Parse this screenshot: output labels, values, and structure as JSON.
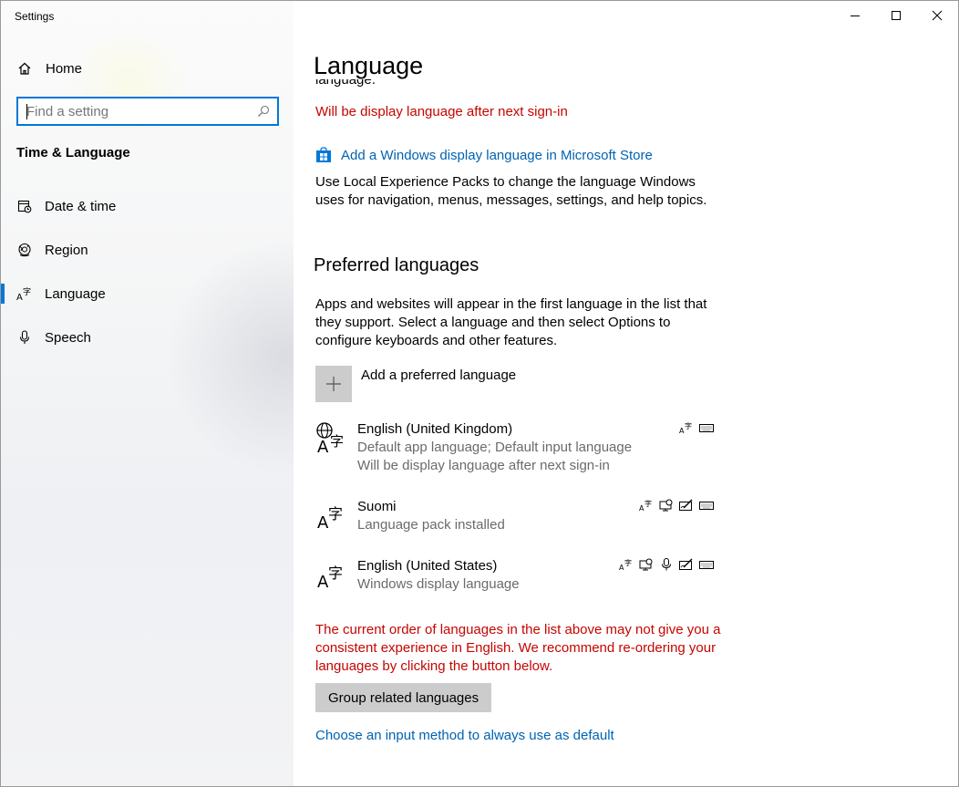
{
  "window": {
    "app_title": "Settings"
  },
  "sidebar": {
    "home_label": "Home",
    "search_placeholder": "Find a setting",
    "section_title": "Time & Language",
    "items": [
      {
        "label": "Date & time",
        "icon": "date-time-icon",
        "selected": false
      },
      {
        "label": "Region",
        "icon": "globe-icon",
        "selected": false
      },
      {
        "label": "Language",
        "icon": "language-icon",
        "selected": true
      },
      {
        "label": "Speech",
        "icon": "microphone-icon",
        "selected": false
      }
    ]
  },
  "main": {
    "page_title": "Language",
    "clipped_text": "language.",
    "display_warning": "Will be display language after next sign-in",
    "store_link": "Add a Windows display language in Microsoft Store",
    "store_desc": "Use Local Experience Packs to change the language Windows uses for navigation, menus, messages, settings, and help topics.",
    "preferred_heading": "Preferred languages",
    "preferred_desc": "Apps and websites will appear in the first language in the list that they support. Select a language and then select Options to configure keyboards and other features.",
    "add_preferred_label": "Add a preferred language",
    "languages": [
      {
        "name": "English (United Kingdom)",
        "sub1": "Default app language; Default input language",
        "sub2": "Will be display language after next sign-in",
        "features": [
          "display-language-icon",
          "keyboard-icon"
        ]
      },
      {
        "name": "Suomi",
        "sub1": "Language pack installed",
        "features": [
          "display-language-icon",
          "speech-recognition-icon",
          "handwriting-icon",
          "keyboard-icon"
        ]
      },
      {
        "name": "English (United States)",
        "sub1": "Windows display language",
        "features": [
          "display-language-icon",
          "speech-recognition-icon",
          "microphone-icon",
          "handwriting-icon",
          "keyboard-icon"
        ]
      }
    ],
    "order_warning": "The current order of languages in the list above may not give you a consistent experience in English. We recommend re-ordering your languages by clicking the button below.",
    "group_button": "Group related languages",
    "input_method_link": "Choose an input method to always use as default"
  },
  "colors": {
    "accent": "#0078d7",
    "link": "#0063b1",
    "warning": "#c50500"
  }
}
